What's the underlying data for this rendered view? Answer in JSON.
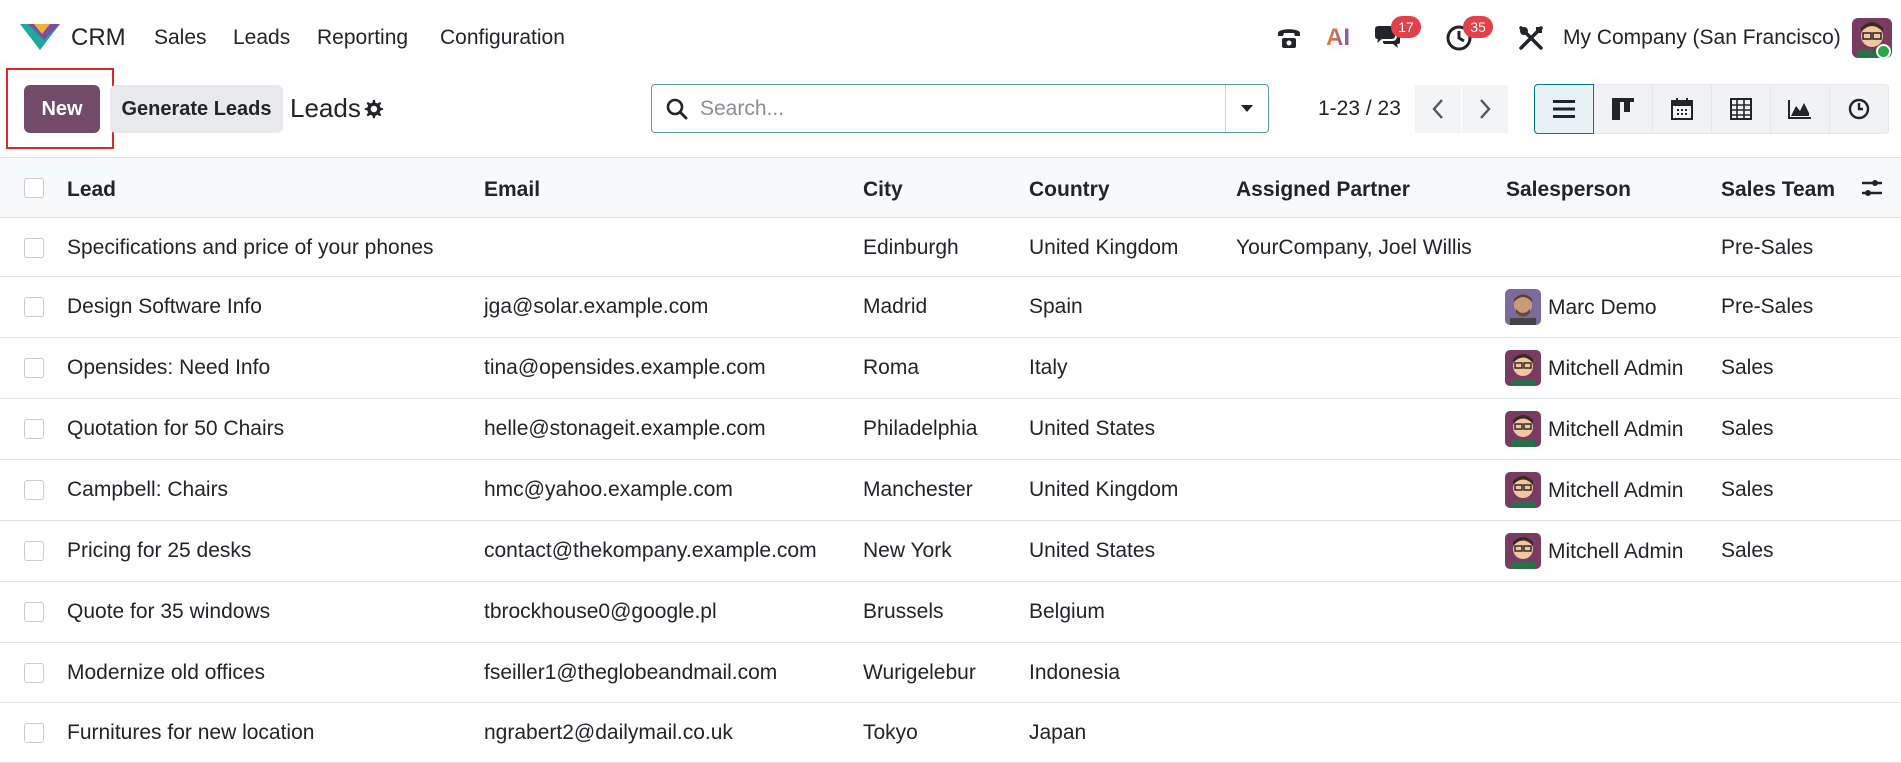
{
  "navbar": {
    "app_name": "CRM",
    "menu": [
      "Sales",
      "Leads",
      "Reporting",
      "Configuration"
    ],
    "messages_badge": "17",
    "activities_badge": "35",
    "ai_label": "AI",
    "company": "My Company (San Francisco)"
  },
  "control": {
    "new_label": "New",
    "generate_label": "Generate Leads",
    "title": "Leads",
    "search_placeholder": "Search...",
    "pager": "1-23 / 23"
  },
  "table": {
    "headers": {
      "lead": "Lead",
      "email": "Email",
      "city": "City",
      "country": "Country",
      "partner": "Assigned Partner",
      "salesperson": "Salesperson",
      "team": "Sales Team"
    },
    "rows": [
      {
        "lead": "Specifications and price of your phones",
        "email": "",
        "city": "Edinburgh",
        "country": "United Kingdom",
        "partner": "YourCompany, Joel Willis",
        "salesperson": "",
        "team": "Pre-Sales"
      },
      {
        "lead": "Design Software Info",
        "email": "jga@solar.example.com",
        "city": "Madrid",
        "country": "Spain",
        "partner": "",
        "salesperson": "Marc Demo",
        "team": "Pre-Sales"
      },
      {
        "lead": "Opensides: Need Info",
        "email": "tina@opensides.example.com",
        "city": "Roma",
        "country": "Italy",
        "partner": "",
        "salesperson": "Mitchell Admin",
        "team": "Sales"
      },
      {
        "lead": "Quotation for 50 Chairs",
        "email": "helle@stonageit.example.com",
        "city": "Philadelphia",
        "country": "United States",
        "partner": "",
        "salesperson": "Mitchell Admin",
        "team": "Sales"
      },
      {
        "lead": "Campbell: Chairs",
        "email": "hmc@yahoo.example.com",
        "city": "Manchester",
        "country": "United Kingdom",
        "partner": "",
        "salesperson": "Mitchell Admin",
        "team": "Sales"
      },
      {
        "lead": "Pricing for 25 desks",
        "email": "contact@thekompany.example.com",
        "city": "New York",
        "country": "United States",
        "partner": "",
        "salesperson": "Mitchell Admin",
        "team": "Sales"
      },
      {
        "lead": "Quote for 35 windows",
        "email": "tbrockhouse0@google.pl",
        "city": "Brussels",
        "country": "Belgium",
        "partner": "",
        "salesperson": "",
        "team": ""
      },
      {
        "lead": "Modernize old offices",
        "email": "fseiller1@theglobeandmail.com",
        "city": "Wurigelebur",
        "country": "Indonesia",
        "partner": "",
        "salesperson": "",
        "team": ""
      },
      {
        "lead": "Furnitures for new location",
        "email": "ngrabert2@dailymail.co.uk",
        "city": "Tokyo",
        "country": "Japan",
        "partner": "",
        "salesperson": "",
        "team": ""
      }
    ]
  },
  "colors": {
    "primary": "#714b67",
    "accent": "#017e84",
    "badge": "#e1414a",
    "highlight": "#e0262c"
  }
}
